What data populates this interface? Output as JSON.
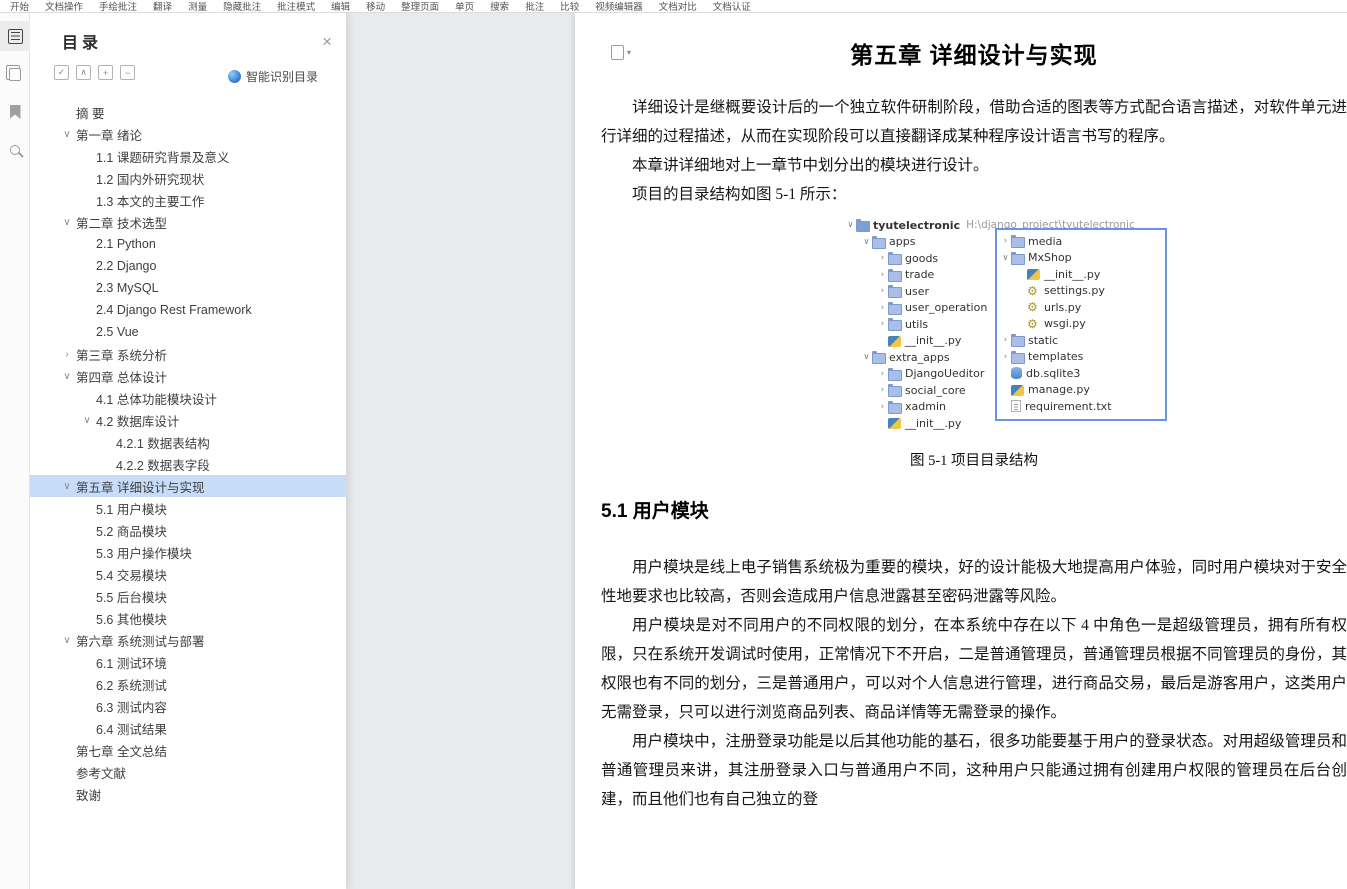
{
  "toolbar": {
    "items": [
      "开始",
      "文档操作",
      "手绘批注",
      "翻译",
      "测量",
      "隐藏批注",
      "批注模式",
      "编辑",
      "移动",
      "整理页面",
      "单页",
      "搜索",
      "批注",
      "比较",
      "视频编辑器",
      "文档对比",
      "文档认证"
    ]
  },
  "toc": {
    "title": "目录",
    "close_glyph": "×",
    "tools": [
      "✓",
      "∧",
      "+",
      "−"
    ],
    "smart_label": "智能识别目录",
    "items": [
      {
        "label": "摘 要",
        "level": 0
      },
      {
        "label": "第一章 绪论",
        "level": 0,
        "arrow": "down"
      },
      {
        "label": "1.1 课题研究背景及意义",
        "level": 1
      },
      {
        "label": "1.2 国内外研究现状",
        "level": 1
      },
      {
        "label": "1.3 本文的主要工作",
        "level": 1
      },
      {
        "label": "第二章 技术选型",
        "level": 0,
        "arrow": "down"
      },
      {
        "label": "2.1 Python",
        "level": 1
      },
      {
        "label": "2.2 Django",
        "level": 1
      },
      {
        "label": "2.3 MySQL",
        "level": 1
      },
      {
        "label": "2.4 Django Rest Framework",
        "level": 1
      },
      {
        "label": "2.5 Vue",
        "level": 1
      },
      {
        "label": "第三章 系统分析",
        "level": 0,
        "arrow": "right"
      },
      {
        "label": "第四章 总体设计",
        "level": 0,
        "arrow": "down"
      },
      {
        "label": "4.1 总体功能模块设计",
        "level": 1
      },
      {
        "label": "4.2 数据库设计",
        "level": 1,
        "arrow": "down"
      },
      {
        "label": "4.2.1 数据表结构",
        "level": 2
      },
      {
        "label": "4.2.2 数据表字段",
        "level": 2
      },
      {
        "label": "第五章 详细设计与实现",
        "level": 0,
        "arrow": "down",
        "selected": true
      },
      {
        "label": "5.1 用户模块",
        "level": 1
      },
      {
        "label": "5.2 商品模块",
        "level": 1
      },
      {
        "label": "5.3 用户操作模块",
        "level": 1
      },
      {
        "label": "5.4 交易模块",
        "level": 1
      },
      {
        "label": "5.5 后台模块",
        "level": 1
      },
      {
        "label": "5.6 其他模块",
        "level": 1
      },
      {
        "label": "第六章 系统测试与部署",
        "level": 0,
        "arrow": "down"
      },
      {
        "label": "6.1 测试环境",
        "level": 1
      },
      {
        "label": "6.2 系统测试",
        "level": 1
      },
      {
        "label": "6.3 测试内容",
        "level": 1
      },
      {
        "label": "6.4 测试结果",
        "level": 1
      },
      {
        "label": "第七章 全文总结",
        "level": 0
      },
      {
        "label": "参考文献",
        "level": 0
      },
      {
        "label": "致谢",
        "level": 0
      }
    ]
  },
  "doc": {
    "page_menu_glyph": "▾",
    "title": "第五章 详细设计与实现",
    "paragraphs": [
      "详细设计是继概要设计后的一个独立软件研制阶段，借助合适的图表等方式配合语言描述，对软件单元进行详细的过程描述，从而在实现阶段可以直接翻译成某种程序设计语言书写的程序。",
      "本章讲详细地对上一章节中划分出的模块进行设计。",
      "项目的目录结构如图 5-1 所示："
    ],
    "figure": {
      "caption": "图 5-1 项目目录结构",
      "tree_left": [
        {
          "label": "tyutelectronic",
          "path": "H:\\django_project\\tyutelectronic",
          "icon": "project",
          "level": 0,
          "arrow": "down",
          "bold": true
        },
        {
          "label": "apps",
          "icon": "folder",
          "level": 1,
          "arrow": "down"
        },
        {
          "label": "goods",
          "icon": "folder",
          "level": 2,
          "arrow": "right"
        },
        {
          "label": "trade",
          "icon": "folder",
          "level": 2,
          "arrow": "right"
        },
        {
          "label": "user",
          "icon": "folder",
          "level": 2,
          "arrow": "right"
        },
        {
          "label": "user_operation",
          "icon": "folder",
          "level": 2,
          "arrow": "right"
        },
        {
          "label": "utils",
          "icon": "folder",
          "level": 2,
          "arrow": "right"
        },
        {
          "label": "__init__.py",
          "icon": "python",
          "level": 2
        },
        {
          "label": "extra_apps",
          "icon": "folder",
          "level": 1,
          "arrow": "down"
        },
        {
          "label": "DjangoUeditor",
          "icon": "folder",
          "level": 2,
          "arrow": "right"
        },
        {
          "label": "social_core",
          "icon": "folder",
          "level": 2,
          "arrow": "right"
        },
        {
          "label": "xadmin",
          "icon": "folder",
          "level": 2,
          "arrow": "right"
        },
        {
          "label": "__init__.py",
          "icon": "python",
          "level": 2
        }
      ],
      "tree_right": [
        {
          "label": "media",
          "icon": "folder",
          "level": 0,
          "arrow": "right"
        },
        {
          "label": "MxShop",
          "icon": "folder",
          "level": 0,
          "arrow": "down"
        },
        {
          "label": "__init__.py",
          "icon": "python",
          "level": 1
        },
        {
          "label": "settings.py",
          "icon": "gear",
          "level": 1
        },
        {
          "label": "urls.py",
          "icon": "gear",
          "level": 1
        },
        {
          "label": "wsgi.py",
          "icon": "gear",
          "level": 1
        },
        {
          "label": "static",
          "icon": "folder",
          "level": 0,
          "arrow": "right"
        },
        {
          "label": "templates",
          "icon": "folder",
          "level": 0,
          "arrow": "right"
        },
        {
          "label": "db.sqlite3",
          "icon": "db",
          "level": 0
        },
        {
          "label": "manage.py",
          "icon": "python",
          "level": 0
        },
        {
          "label": "requirement.txt",
          "icon": "txt",
          "level": 0
        }
      ]
    },
    "section": {
      "heading": "5.1 用户模块",
      "paragraphs": [
        "用户模块是线上电子销售系统极为重要的模块，好的设计能极大地提高用户体验，同时用户模块对于安全性地要求也比较高，否则会造成用户信息泄露甚至密码泄露等风险。",
        "用户模块是对不同用户的不同权限的划分，在本系统中存在以下 4 中角色一是超级管理员，拥有所有权限，只在系统开发调试时使用，正常情况下不开启，二是普通管理员，普通管理员根据不同管理员的身份，其权限也有不同的划分，三是普通用户，可以对个人信息进行管理，进行商品交易，最后是游客用户，这类用户无需登录，只可以进行浏览商品列表、商品详情等无需登录的操作。",
        "用户模块中，注册登录功能是以后其他功能的基石，很多功能要基于用户的登录状态。对用超级管理员和普通管理员来讲，其注册登录入口与普通用户不同，这种用户只能通过拥有创建用户权限的管理员在后台创建，而且他们也有自己独立的登"
      ]
    }
  }
}
